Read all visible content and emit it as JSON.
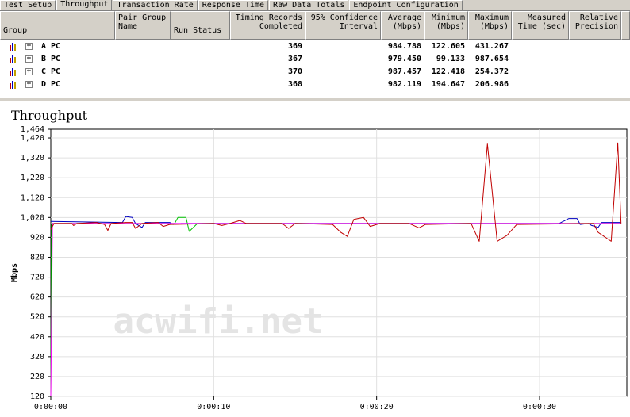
{
  "tabs": [
    {
      "label": "Test Setup"
    },
    {
      "label": "Throughput",
      "active": true
    },
    {
      "label": "Transaction Rate"
    },
    {
      "label": "Response Time"
    },
    {
      "label": "Raw Data Totals"
    },
    {
      "label": "Endpoint Configuration"
    }
  ],
  "table": {
    "headers": {
      "group": "Group",
      "pair_group": "Pair Group\nName",
      "run_status": "Run Status",
      "timing": "Timing Records\nCompleted",
      "confidence": "95% Confidence\nInterval",
      "average": "Average\n(Mbps)",
      "minimum": "Minimum\n(Mbps)",
      "maximum": "Maximum\n(Mbps)",
      "measured": "Measured\nTime (sec)",
      "precision": "Relative\nPrecision"
    },
    "rows": [
      {
        "group": "A  PC",
        "records": "369",
        "average": "984.788",
        "minimum": "122.605",
        "maximum": "431.267"
      },
      {
        "group": "B  PC",
        "records": "367",
        "average": "979.450",
        "minimum": "99.133",
        "maximum": "987.654"
      },
      {
        "group": "C  PC",
        "records": "370",
        "average": "987.457",
        "minimum": "122.418",
        "maximum": "254.372"
      },
      {
        "group": "D  PC",
        "records": "368",
        "average": "982.119",
        "minimum": "194.647",
        "maximum": "206.986"
      }
    ]
  },
  "chart_data": {
    "type": "line",
    "title": "Throughput",
    "ylabel": "Mbps",
    "xlabel": "",
    "ylim": [
      120,
      1464
    ],
    "yticks": [
      "1,464",
      "1,420",
      "1,320",
      "1,220",
      "1,120",
      "1,020",
      "920",
      "820",
      "720",
      "620",
      "520",
      "420",
      "320",
      "220",
      "120"
    ],
    "xticks": [
      "0:00:00",
      "0:00:10",
      "0:00:20",
      "0:00:30"
    ],
    "watermark": "acwifi.net",
    "series": [
      {
        "color": "#c0c0c0",
        "points": [
          [
            0,
            990
          ],
          [
            35,
            990
          ]
        ]
      },
      {
        "color": "#00c000",
        "points": [
          [
            0,
            120
          ],
          [
            0.05,
            990
          ],
          [
            7.6,
            990
          ],
          [
            7.8,
            1020
          ],
          [
            8.3,
            1020
          ],
          [
            8.5,
            950
          ],
          [
            9,
            990
          ],
          [
            35,
            990
          ]
        ]
      },
      {
        "color": "#0000c0",
        "points": [
          [
            0,
            1000
          ],
          [
            4.4,
            995
          ],
          [
            4.6,
            1025
          ],
          [
            5,
            1020
          ],
          [
            5.2,
            990
          ],
          [
            5.6,
            970
          ],
          [
            5.8,
            995
          ],
          [
            7.3,
            995
          ],
          [
            7.5,
            985
          ],
          [
            8,
            990
          ],
          [
            31.2,
            990
          ],
          [
            31.8,
            1015
          ],
          [
            32.3,
            1015
          ],
          [
            32.5,
            985
          ],
          [
            33,
            990
          ],
          [
            33.2,
            980
          ],
          [
            33.6,
            970
          ],
          [
            33.8,
            995
          ],
          [
            35,
            995
          ]
        ]
      },
      {
        "color": "#ff00ff",
        "points": [
          [
            0,
            120
          ],
          [
            0.1,
            990
          ],
          [
            35,
            990
          ]
        ]
      },
      {
        "color": "#c00000",
        "points": [
          [
            0,
            960
          ],
          [
            0.2,
            990
          ],
          [
            1.3,
            990
          ],
          [
            1.4,
            980
          ],
          [
            1.6,
            990
          ],
          [
            2.8,
            995
          ],
          [
            3.3,
            985
          ],
          [
            3.5,
            955
          ],
          [
            3.7,
            990
          ],
          [
            4.6,
            995
          ],
          [
            5,
            995
          ],
          [
            5.2,
            965
          ],
          [
            5.6,
            990
          ],
          [
            6.6,
            995
          ],
          [
            6.9,
            975
          ],
          [
            7.3,
            985
          ],
          [
            10,
            990
          ],
          [
            10.5,
            980
          ],
          [
            11,
            990
          ],
          [
            11.6,
            1005
          ],
          [
            12,
            990
          ],
          [
            14.2,
            990
          ],
          [
            14.6,
            965
          ],
          [
            15,
            990
          ],
          [
            17.3,
            985
          ],
          [
            17.8,
            945
          ],
          [
            18.2,
            925
          ],
          [
            18.6,
            1010
          ],
          [
            19.2,
            1020
          ],
          [
            19.6,
            975
          ],
          [
            20.2,
            990
          ],
          [
            22,
            990
          ],
          [
            22.6,
            968
          ],
          [
            23,
            985
          ],
          [
            25.8,
            990
          ],
          [
            26.3,
            900
          ],
          [
            26.8,
            1390
          ],
          [
            27.4,
            900
          ],
          [
            28,
            930
          ],
          [
            28.6,
            985
          ],
          [
            33.3,
            990
          ],
          [
            33.6,
            945
          ],
          [
            34.4,
            900
          ],
          [
            34.8,
            1395
          ],
          [
            35,
            990
          ]
        ]
      }
    ]
  }
}
